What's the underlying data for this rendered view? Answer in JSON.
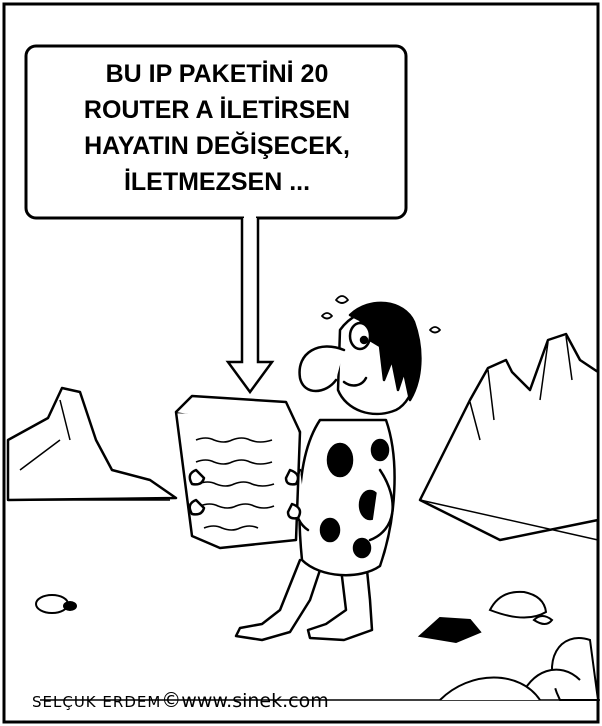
{
  "speech_bubble": {
    "lines": [
      "BU IP PAKETİNİ 20",
      "ROUTER A İLETİRSEN",
      "HAYATIN DEĞİŞECEK,",
      "İLETMEZSEN ..."
    ]
  },
  "signature": {
    "artist": "SELÇUK ERDEM",
    "copyright": "©",
    "site": "www.sinek.com"
  },
  "tablet_text": "illegible scribbles",
  "colors": {
    "ink": "#000000",
    "paper": "#ffffff"
  }
}
